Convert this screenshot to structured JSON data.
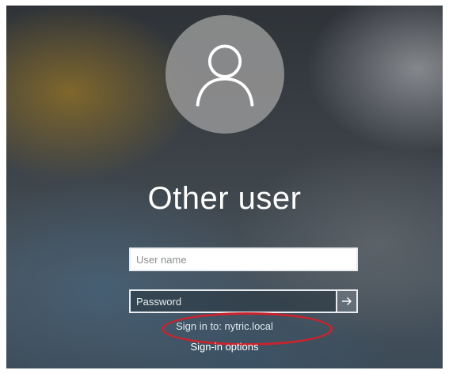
{
  "login": {
    "avatar_icon": "user-silhouette-icon",
    "title": "Other user",
    "username": {
      "value": "",
      "placeholder": "User name"
    },
    "password": {
      "value": "",
      "placeholder": "Password"
    },
    "submit_icon": "arrow-right-icon",
    "sign_in_domain": "Sign in to: nytric.local",
    "sign_in_options": "Sign-in options"
  },
  "colors": {
    "annotation_ellipse": "#c8242e",
    "field_border": "#e9ecef",
    "text": "#ffffff"
  }
}
